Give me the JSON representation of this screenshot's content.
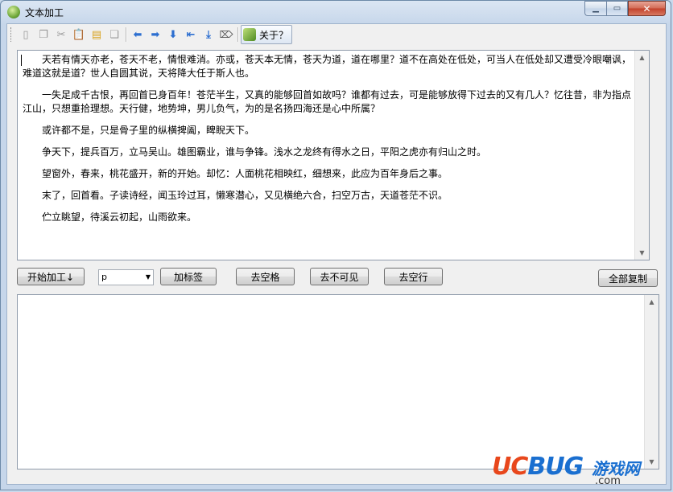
{
  "window": {
    "title": "文本加工"
  },
  "toolbar": {
    "items": [
      {
        "icon": "new-file-icon",
        "glyph": "▯"
      },
      {
        "icon": "copy-icon",
        "glyph": "❐"
      },
      {
        "icon": "cut-icon",
        "glyph": "✂"
      },
      {
        "icon": "paste-icon",
        "glyph": "📋"
      },
      {
        "icon": "open-folder-icon",
        "glyph": "▤"
      },
      {
        "icon": "save-icon",
        "glyph": "❏"
      },
      {
        "icon": "arrow-left-icon",
        "glyph": "⬅"
      },
      {
        "icon": "arrow-right-icon",
        "glyph": "➡"
      },
      {
        "icon": "arrow-down-icon",
        "glyph": "⬇"
      },
      {
        "icon": "arrow-to-start-icon",
        "glyph": "⇤"
      },
      {
        "icon": "download-icon",
        "glyph": "⤓"
      },
      {
        "icon": "tag-icon",
        "glyph": "⌦"
      }
    ],
    "about_label": "关于？"
  },
  "editor": {
    "paragraphs": [
      "天若有情天亦老，苍天不老，情恨难消。亦或，苍天本无情，苍天为道，道在哪里？道不在高处在低处，可当人在低处却又遭受冷眼嘲讽，难道这就是道？世人自圆其说，天将降大任于斯人也。",
      "一失足成千古恨，再回首已身百年！苍茫半生，又真的能够回首如故吗？谁都有过去，可是能够放得下过去的又有几人？忆往昔，非为指点江山，只想重拾理想。天行健，地势坤，男儿负气，为的是名扬四海还是心中所属？",
      "或许都不是，只是骨子里的纵横捭阖，睥睨天下。",
      "争天下，提兵百万，立马吴山。雄图霸业，谁与争锋。浅水之龙终有得水之日，平阳之虎亦有归山之时。",
      "望窗外，春来，桃花盛开，新的开始。却忆：人面桃花相映红，细想来，此应为百年身后之事。",
      "末了，回首看。子读诗经，闻玉玲过耳，懒寒潜心，又见横绝六合，扫空万古，天道苍茫不识。",
      "伫立眺望，待溪云初起，山雨欲来。"
    ]
  },
  "controls": {
    "start_label": "开始加工↓",
    "tag_select_value": "p",
    "add_tag_label": "加标签",
    "remove_spaces_label": "去空格",
    "remove_invisible_label": "去不可见",
    "remove_empty_lines_label": "去空行",
    "copy_all_label": "全部复制"
  },
  "watermark": {
    "uc": "UC",
    "bug": "BUG",
    "side": "游戏网",
    "domain": ".com"
  }
}
